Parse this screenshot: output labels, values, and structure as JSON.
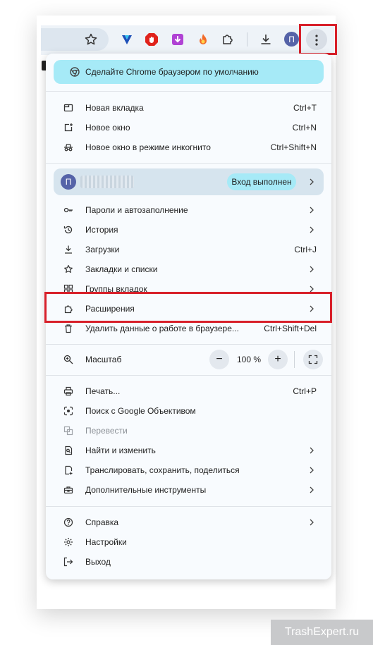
{
  "toolbar": {
    "icons": [
      "star-icon",
      "vpn-extension-icon",
      "adblock-extension-icon",
      "save-extension-icon",
      "fire-extension-icon",
      "puzzle-icon",
      "download-icon"
    ],
    "profile_initial": "П"
  },
  "menu": {
    "banner": "Сделайте Chrome браузером по умолчанию",
    "group1": [
      {
        "label": "Новая вкладка",
        "shortcut": "Ctrl+T",
        "icon": "new-tab-icon"
      },
      {
        "label": "Новое окно",
        "shortcut": "Ctrl+N",
        "icon": "new-window-icon"
      },
      {
        "label": "Новое окно в режиме инкогнито",
        "shortcut": "Ctrl+Shift+N",
        "icon": "incognito-icon"
      }
    ],
    "profile": {
      "initial": "П",
      "status": "Вход выполнен"
    },
    "group2": [
      {
        "label": "Пароли и автозаполнение",
        "shortcut": "",
        "submenu": true,
        "icon": "key-icon"
      },
      {
        "label": "История",
        "shortcut": "",
        "submenu": true,
        "icon": "history-icon"
      },
      {
        "label": "Загрузки",
        "shortcut": "Ctrl+J",
        "submenu": false,
        "icon": "download-icon"
      },
      {
        "label": "Закладки и списки",
        "shortcut": "",
        "submenu": true,
        "icon": "star-icon"
      },
      {
        "label": "Группы вкладок",
        "shortcut": "",
        "submenu": true,
        "icon": "tab-groups-icon"
      },
      {
        "label": "Расширения",
        "shortcut": "",
        "submenu": true,
        "icon": "puzzle-icon"
      },
      {
        "label": "Удалить данные о работе в браузере...",
        "shortcut": "Ctrl+Shift+Del",
        "submenu": false,
        "icon": "trash-icon"
      }
    ],
    "zoom": {
      "label": "Масштаб",
      "minus": "−",
      "value": "100 %",
      "plus": "+"
    },
    "group3": [
      {
        "label": "Печать...",
        "shortcut": "Ctrl+P",
        "submenu": false,
        "icon": "print-icon",
        "disabled": false
      },
      {
        "label": "Поиск с Google Объективом",
        "shortcut": "",
        "submenu": false,
        "icon": "lens-icon",
        "disabled": false
      },
      {
        "label": "Перевести",
        "shortcut": "",
        "submenu": false,
        "icon": "translate-icon",
        "disabled": true
      },
      {
        "label": "Найти и изменить",
        "shortcut": "",
        "submenu": true,
        "icon": "find-icon",
        "disabled": false
      },
      {
        "label": "Транслировать, сохранить, поделиться",
        "shortcut": "",
        "submenu": true,
        "icon": "cast-icon",
        "disabled": false
      },
      {
        "label": "Дополнительные инструменты",
        "shortcut": "",
        "submenu": true,
        "icon": "toolbox-icon",
        "disabled": false
      }
    ],
    "group4": [
      {
        "label": "Справка",
        "shortcut": "",
        "submenu": true,
        "icon": "help-icon"
      },
      {
        "label": "Настройки",
        "shortcut": "",
        "submenu": false,
        "icon": "gear-icon"
      },
      {
        "label": "Выход",
        "shortcut": "",
        "submenu": false,
        "icon": "exit-icon"
      }
    ]
  },
  "watermark": "TrashExpert.ru",
  "colors": {
    "highlight": "#d8202a",
    "banner": "#a6eaf7",
    "menu_bg": "#f8fbfe"
  }
}
